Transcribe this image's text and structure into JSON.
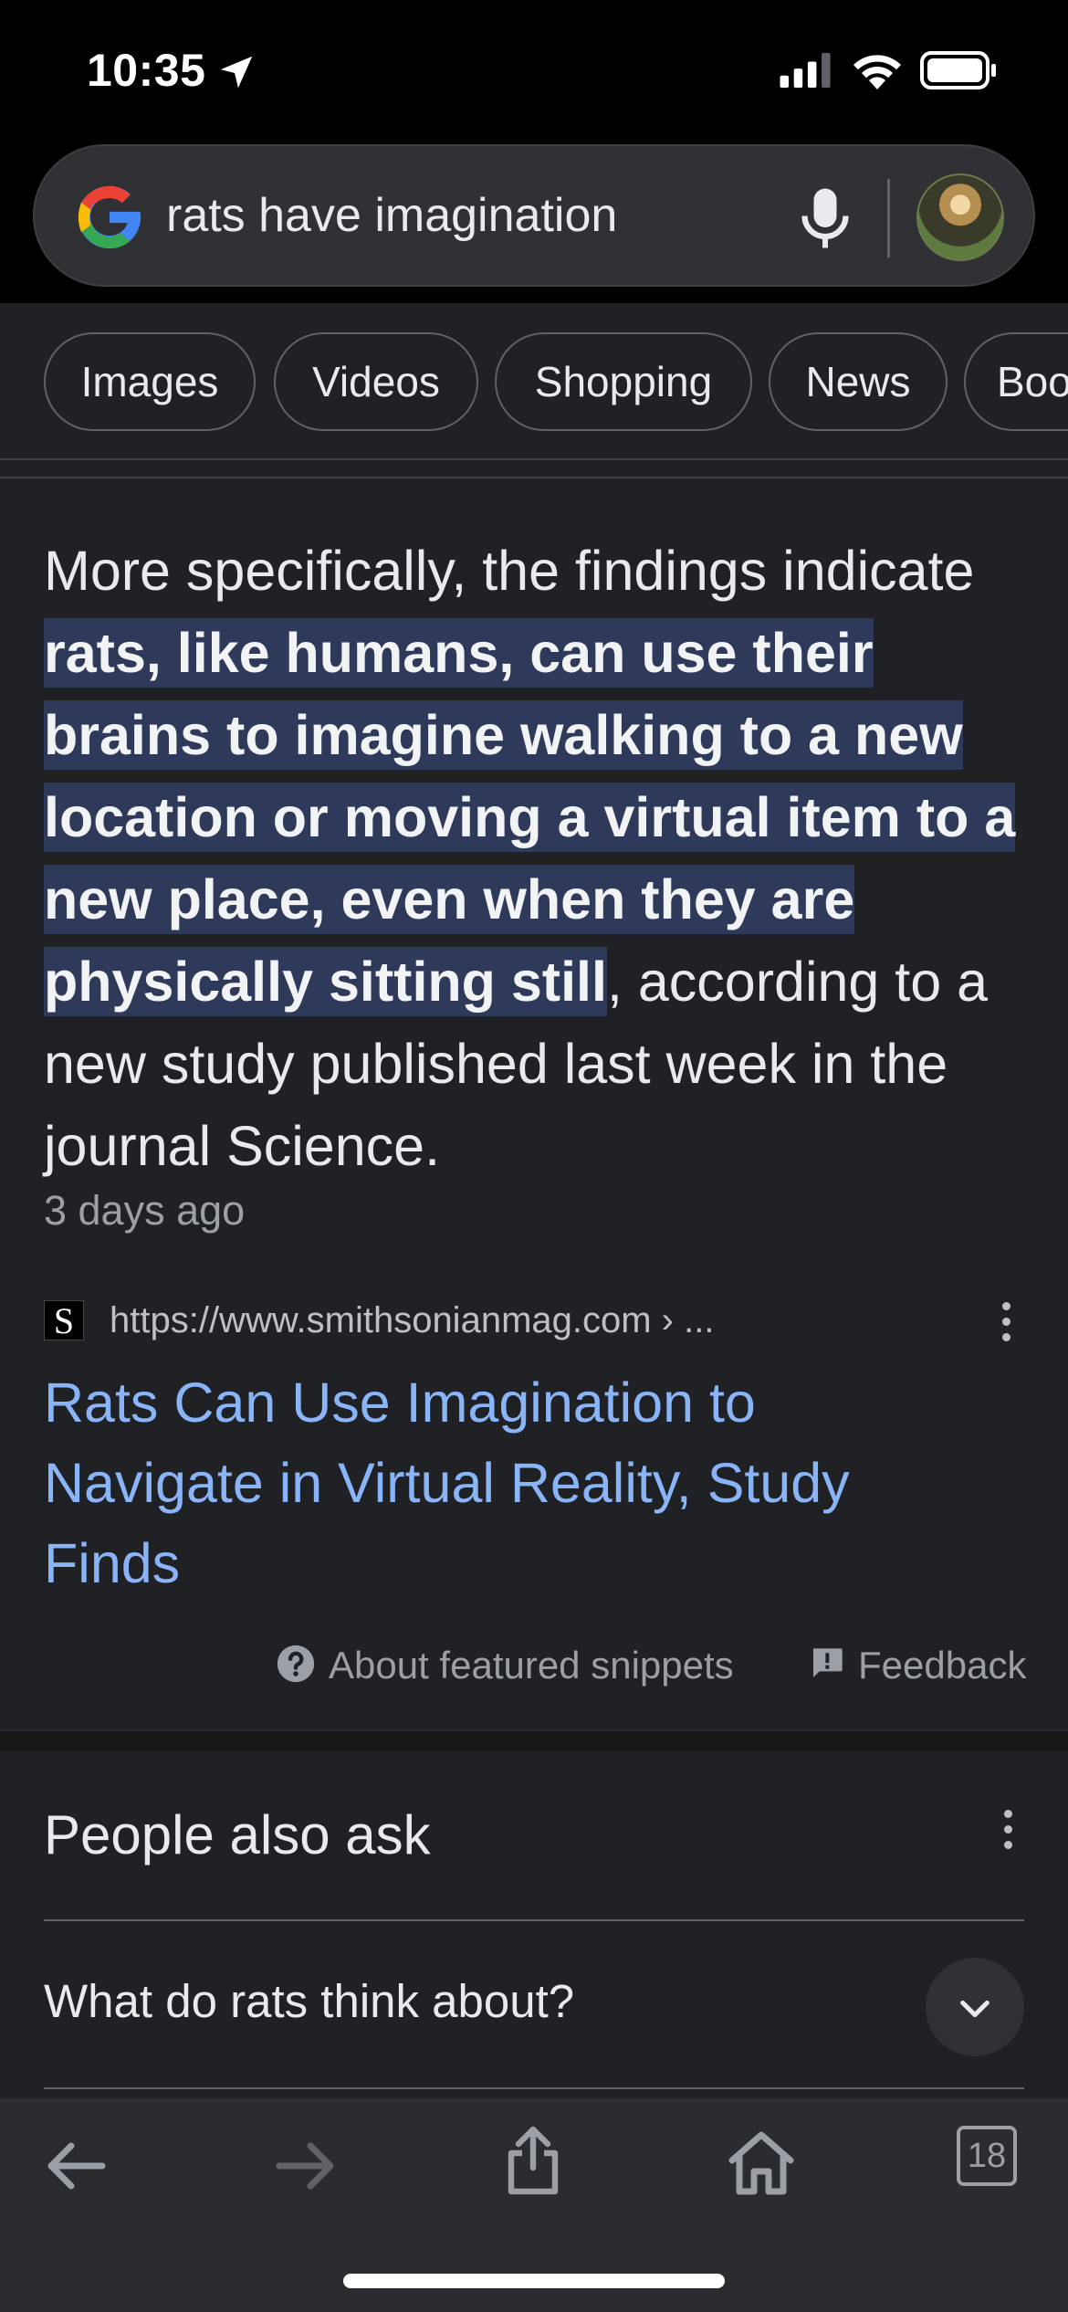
{
  "status_bar": {
    "time": "10:35"
  },
  "search": {
    "query": "rats have imagination"
  },
  "chips": [
    "Images",
    "Videos",
    "Shopping",
    "News",
    "Books"
  ],
  "snippet": {
    "text_before": "More specifically, the findings indicate ",
    "text_highlight": "rats, like humans, can use their brains to imagine walking to a new location or moving a virtual item to a new place, even when they are physically sitting still",
    "text_after": ", according to a new study published last week in the journal Science.",
    "date": "3 days ago"
  },
  "source": {
    "favicon_letter": "S",
    "url": "https://www.smithsonianmag.com › ...",
    "title": "Rats Can Use Imagination to Navigate in Virtual Reality, Study Finds"
  },
  "footer_links": {
    "about": "About featured snippets",
    "feedback": "Feedback"
  },
  "people_also_ask": {
    "title": "People also ask",
    "questions": [
      "What do rats think about?"
    ]
  },
  "toolbar": {
    "tabs_count": "18"
  },
  "colors": {
    "background": "#202124",
    "link": "#8ab4f8",
    "highlight": "#2f3a5b"
  },
  "icons": [
    "location-arrow-icon",
    "signal-icon",
    "wifi-icon",
    "battery-icon",
    "google-logo-icon",
    "mic-icon",
    "help-icon",
    "feedback-icon",
    "more-vert-icon",
    "chevron-down-icon",
    "back-icon",
    "forward-icon",
    "share-icon",
    "home-icon",
    "tabs-icon"
  ]
}
